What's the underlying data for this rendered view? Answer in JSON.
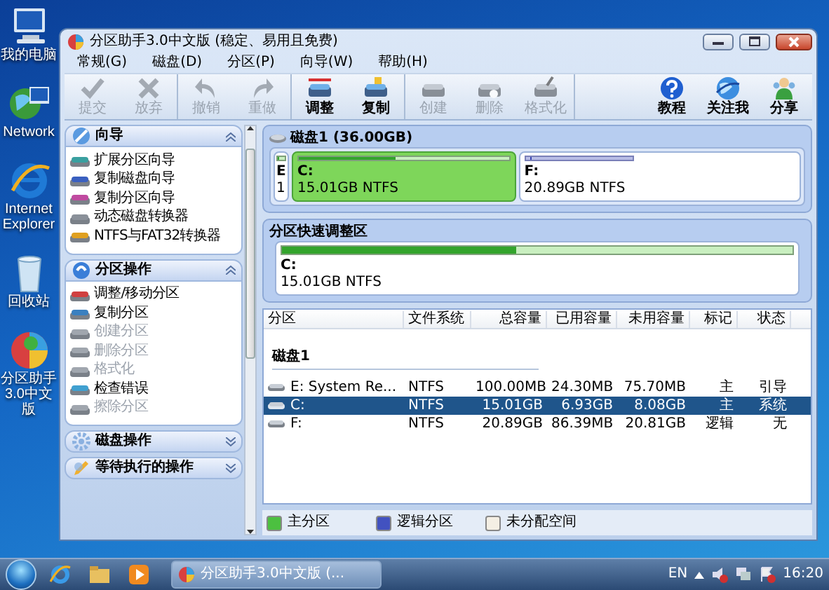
{
  "desktop_icons": [
    {
      "label": "我的电脑"
    },
    {
      "label": "Network"
    },
    {
      "label": "Internet Explorer"
    },
    {
      "label": "回收站"
    },
    {
      "label": "分区助手3.0中文版"
    }
  ],
  "window": {
    "title": "分区助手3.0中文版 (稳定、易用且免费)"
  },
  "menu": [
    "常规(G)",
    "磁盘(D)",
    "分区(P)",
    "向导(W)",
    "帮助(H)"
  ],
  "toolbar": [
    [
      {
        "label": "提交",
        "disabled": true
      },
      {
        "label": "放弃",
        "disabled": true
      }
    ],
    [
      {
        "label": "撤销",
        "disabled": true
      },
      {
        "label": "重做",
        "disabled": true
      }
    ],
    [
      {
        "label": "调整",
        "disabled": false
      },
      {
        "label": "复制",
        "disabled": false
      }
    ],
    [
      {
        "label": "创建",
        "disabled": true
      },
      {
        "label": "删除",
        "disabled": true
      },
      {
        "label": "格式化",
        "disabled": true
      }
    ],
    [
      {
        "label": "教程",
        "disabled": false
      },
      {
        "label": "关注我",
        "disabled": false
      },
      {
        "label": "分享",
        "disabled": false
      }
    ]
  ],
  "sidebar": [
    {
      "title": "向导",
      "expanded": true,
      "items": [
        {
          "label": "扩展分区向导",
          "disabled": false
        },
        {
          "label": "复制磁盘向导",
          "disabled": false
        },
        {
          "label": "复制分区向导",
          "disabled": false
        },
        {
          "label": "动态磁盘转换器",
          "disabled": false
        },
        {
          "label": "NTFS与FAT32转换器",
          "disabled": false
        }
      ]
    },
    {
      "title": "分区操作",
      "expanded": true,
      "items": [
        {
          "label": "调整/移动分区",
          "disabled": false
        },
        {
          "label": "复制分区",
          "disabled": false
        },
        {
          "label": "创建分区",
          "disabled": true
        },
        {
          "label": "删除分区",
          "disabled": true
        },
        {
          "label": "格式化",
          "disabled": true
        },
        {
          "label": "检查错误",
          "disabled": false
        },
        {
          "label": "擦除分区",
          "disabled": true
        }
      ]
    },
    {
      "title": "磁盘操作",
      "expanded": false
    },
    {
      "title": "等待执行的操作",
      "expanded": false
    }
  ],
  "disk": {
    "title": "磁盘1 (36.00GB)",
    "partitions": [
      {
        "kind": "primary",
        "letter": "E",
        "info": "1",
        "level": 0.24,
        "selected": false
      },
      {
        "kind": "primary",
        "letter": "C:",
        "info": "15.01GB NTFS",
        "level": 0.46,
        "selected": true
      },
      {
        "kind": "logical",
        "letter": "F:",
        "info": "20.89GB NTFS",
        "level": 0.004,
        "selected": false
      }
    ]
  },
  "quick_resize": {
    "title": "分区快速调整区",
    "letter": "C:",
    "info": "15.01GB NTFS",
    "level": 0.46
  },
  "table": {
    "columns": [
      "分区",
      "文件系统",
      "总容量",
      "已用容量",
      "未用容量",
      "标记",
      "状态"
    ],
    "group": "磁盘1",
    "rows": [
      {
        "cells": [
          "E:  System Re...",
          "NTFS",
          "100.00MB",
          "24.30MB",
          "75.70MB",
          "主",
          "引导"
        ],
        "selected": false
      },
      {
        "cells": [
          "C:",
          "NTFS",
          "15.01GB",
          "6.93GB",
          "8.08GB",
          "主",
          "系统"
        ],
        "selected": true
      },
      {
        "cells": [
          "F:",
          "NTFS",
          "20.89GB",
          "86.39MB",
          "20.81GB",
          "逻辑",
          "无"
        ],
        "selected": false
      }
    ]
  },
  "legend": [
    {
      "label": "主分区",
      "color": "#4cc040"
    },
    {
      "label": "逻辑分区",
      "color": "#4252c0"
    },
    {
      "label": "未分配空间",
      "color": "#f4efe4"
    }
  ],
  "taskbar": {
    "task": "分区助手3.0中文版 (...",
    "language": "EN",
    "clock": "16:20"
  }
}
